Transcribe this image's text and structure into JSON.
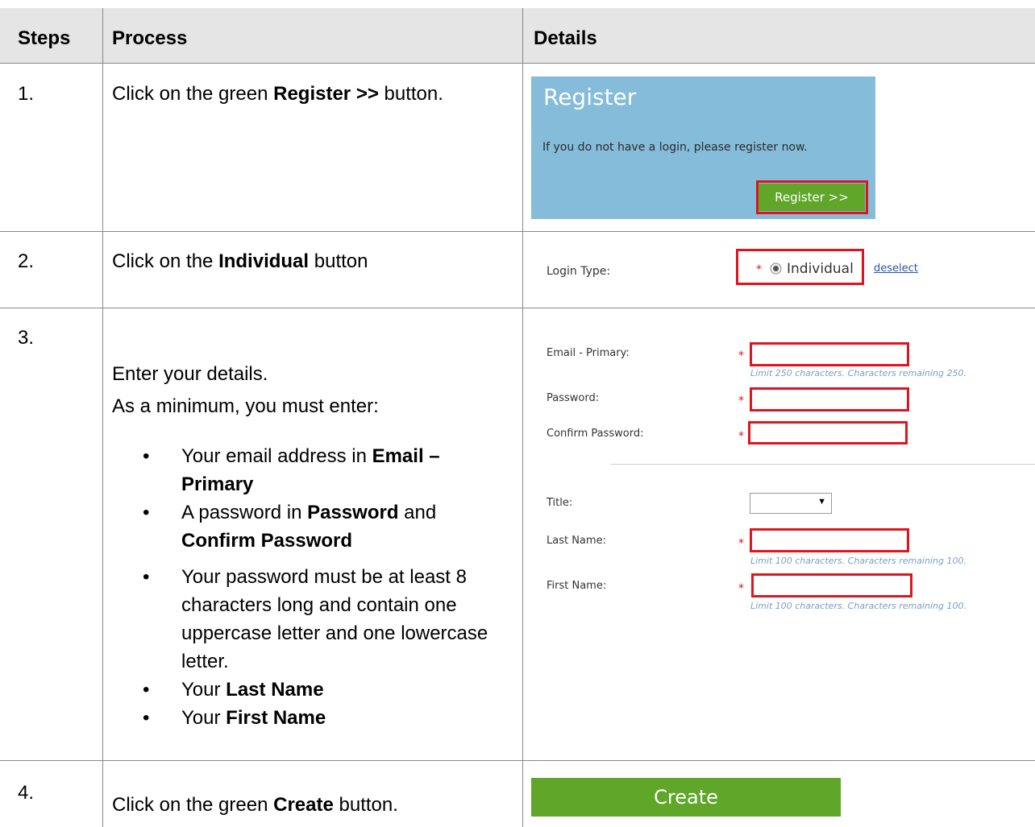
{
  "table": {
    "headers": {
      "steps": "Steps",
      "process": "Process",
      "details": "Details"
    }
  },
  "rows": [
    {
      "num": "1.",
      "process": {
        "pre": "Click on the green ",
        "bold": "Register >>",
        "post": " button."
      },
      "details": {
        "title": "Register",
        "text": "If you do not have a login, please register now.",
        "button": "Register >>"
      }
    },
    {
      "num": "2.",
      "process": {
        "pre": "Click on the ",
        "bold": "Individual",
        "post": " button"
      },
      "details": {
        "label": "Login Type:",
        "star": "*",
        "radio_label": "Individual",
        "deselect": "deselect"
      }
    },
    {
      "num": "3.",
      "process": {
        "line1": "Enter your details.",
        "line2": "As a minimum, you must enter:",
        "bullets": [
          {
            "a": "Your email address in ",
            "b": "Email – Primary",
            "c": ""
          },
          {
            "a": "A password in ",
            "b": "Password",
            "c": " and ",
            "d": "Confirm Password"
          },
          {
            "a": "Your password must be at least 8 characters long and contain one uppercase letter and one lowercase letter."
          },
          {
            "a": "Your ",
            "b": "Last Name"
          },
          {
            "a": "Your ",
            "b": "First Name"
          }
        ],
        "bullet_char": "•"
      },
      "details": {
        "email_label": "Email - Primary:",
        "email_hint": "Limit 250 characters. Characters remaining 250.",
        "password_label": "Password:",
        "confirm_label": "Confirm Password:",
        "title_label": "Title:",
        "select_arrow": "▼",
        "last_label": "Last Name:",
        "last_hint": "Limit 100 characters. Characters remaining 100.",
        "first_label": "First Name:",
        "first_hint": "Limit 100 characters. Characters remaining 100.",
        "star": "*"
      }
    },
    {
      "num": "4.",
      "process": {
        "pre": "Click on the green ",
        "bold": "Create",
        "post": " button."
      },
      "details": {
        "button": "Create"
      }
    }
  ],
  "colors": {
    "header_bg": "#e5e5e5",
    "panel_blue": "#85bcd9",
    "button_green": "#5fa629",
    "highlight_red": "#e0141e"
  }
}
